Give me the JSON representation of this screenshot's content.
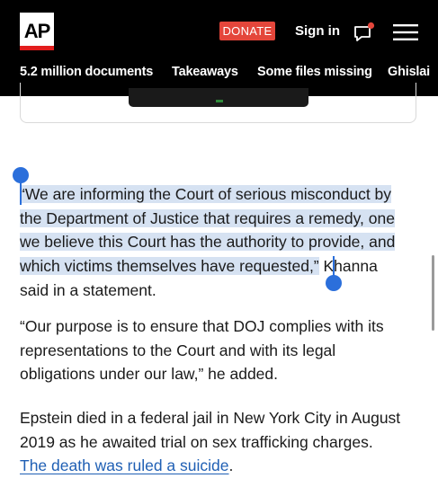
{
  "header": {
    "logo_text": "AP",
    "donate_label": "DONATE",
    "signin_label": "Sign in",
    "chat_icon": "chat-notification-icon",
    "menu_icon": "hamburger-menu-icon",
    "colors": {
      "background": "#000000",
      "donate": "#e4463b",
      "notification_dot": "#e4463b"
    }
  },
  "subnav": {
    "items": [
      {
        "label": "5.2 million documents"
      },
      {
        "label": "Takeaways"
      },
      {
        "label": "Some files missing"
      },
      {
        "label": "Ghislai"
      }
    ]
  },
  "article": {
    "para1": {
      "lines": [
        "“We are informing the Court of serious misconduct by",
        "the Department of Justice that requires a remedy, one",
        "we believe this Court has the authority to provide, and",
        "which victims themselves have requested,”"
      ],
      "line4_rest": " Khanna",
      "line5": "said in a statement."
    },
    "para2": {
      "lines": [
        "“Our purpose is to ensure that DOJ complies with its",
        "representations to the Court and with its legal",
        "obligations under our law,” he added."
      ]
    },
    "para3": {
      "lines": [
        "Epstein died in a federal jail in New York City in August",
        "2019 as he awaited trial on sex trafficking charges."
      ],
      "link_text": "The death was ruled a suicide",
      "link_after": "."
    },
    "colors": {
      "selection": "#d6e2f2",
      "handle": "#2b6fdb",
      "link": "#1f5fb4"
    }
  }
}
